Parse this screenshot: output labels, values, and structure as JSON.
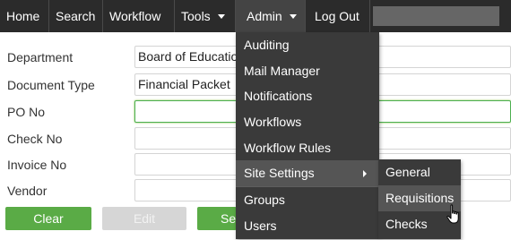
{
  "navbar": {
    "items": [
      {
        "label": "Home"
      },
      {
        "label": "Search"
      },
      {
        "label": "Workflow"
      },
      {
        "label": "Tools"
      },
      {
        "label": "Admin"
      },
      {
        "label": "Log Out"
      }
    ]
  },
  "form": {
    "department": {
      "label": "Department",
      "value": "Board of Education"
    },
    "document_type": {
      "label": "Document Type",
      "value": "Financial Packet"
    },
    "po_no": {
      "label": "PO No",
      "value": ""
    },
    "check_no": {
      "label": "Check No",
      "value": ""
    },
    "invoice_no": {
      "label": "Invoice No",
      "value": ""
    },
    "vendor": {
      "label": "Vendor",
      "value": ""
    }
  },
  "buttons": {
    "clear": "Clear",
    "edit": "Edit",
    "search": "Search"
  },
  "admin_menu": {
    "items": [
      {
        "label": "Auditing"
      },
      {
        "label": "Mail Manager"
      },
      {
        "label": "Notifications"
      },
      {
        "label": "Workflows"
      },
      {
        "label": "Workflow Rules"
      },
      {
        "label": "Site Settings"
      },
      {
        "label": "Groups"
      },
      {
        "label": "Users"
      }
    ]
  },
  "site_settings_submenu": {
    "items": [
      {
        "label": "General"
      },
      {
        "label": "Requisitions"
      },
      {
        "label": "Checks"
      }
    ]
  },
  "colors": {
    "navbar": "#2b2b2b",
    "menu": "#3a3a3a",
    "accent_green": "#5aab46"
  }
}
